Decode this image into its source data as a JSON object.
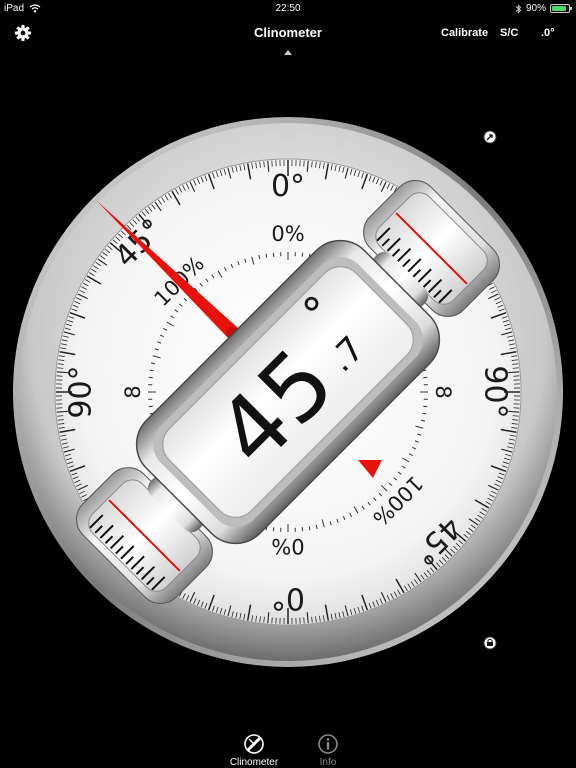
{
  "status": {
    "device": "iPad",
    "time": "22:50",
    "battery": "90%",
    "battery_level": 0.9
  },
  "nav": {
    "title": "Clinometer",
    "calibrate": "Calibrate",
    "sc": "S/C",
    "precision": ".0°"
  },
  "dial": {
    "readout_main": "45",
    "readout_decimal": ".7",
    "readout_degree": "°",
    "angle_deg": 45.7,
    "outer_labels": {
      "top": "0°",
      "bottom": "0°",
      "left": "90°",
      "right": "90°",
      "upper_left": "45°",
      "lower_right": "45°"
    },
    "inner_labels": {
      "top": "0%",
      "bottom": "0%",
      "left": "8",
      "right": "8",
      "upper_left": "100%",
      "lower_right": "100%"
    },
    "accent": "#e8120c"
  },
  "tabs": [
    {
      "label": "Clinometer",
      "icon": "clinometer-icon",
      "selected": true
    },
    {
      "label": "Info",
      "icon": "info-icon",
      "selected": false
    }
  ]
}
